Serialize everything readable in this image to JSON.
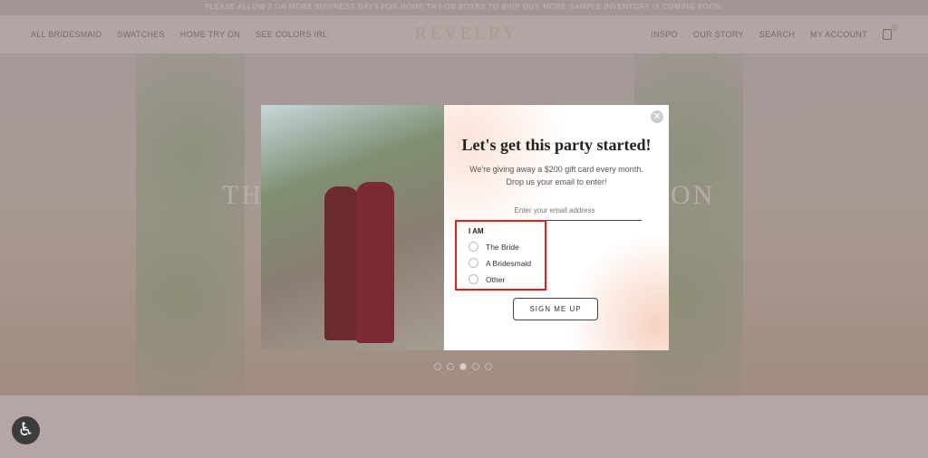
{
  "banner": "PLEASE ALLOW 2 OR MORE BUSINESS DAYS FOR HOME TRY-ON BOXES TO SHIP OUT. MORE SAMPLE INVENTORY IS COMING SOON.",
  "nav": {
    "left": [
      "ALL BRIDESMAID",
      "SWATCHES",
      "HOME TRY ON",
      "SEE COLORS IRL"
    ],
    "logo": "REVELRY",
    "right": [
      "INSPO",
      "OUR STORY",
      "SEARCH",
      "MY ACCOUNT"
    ]
  },
  "hero": {
    "text_left": "TH",
    "text_right": "ON"
  },
  "modal": {
    "title": "Let's get this party started!",
    "subtitle1": "We're giving away a $200 gift card every month.",
    "subtitle2": "Drop us your email to enter!",
    "email_placeholder": "Enter your email address",
    "iam_label": "I AM",
    "options": [
      "The Bride",
      "A Bridesmaid",
      "Other"
    ],
    "submit": "SIGN ME UP",
    "close": "✕"
  },
  "accessibility_icon": "accessibility-icon"
}
